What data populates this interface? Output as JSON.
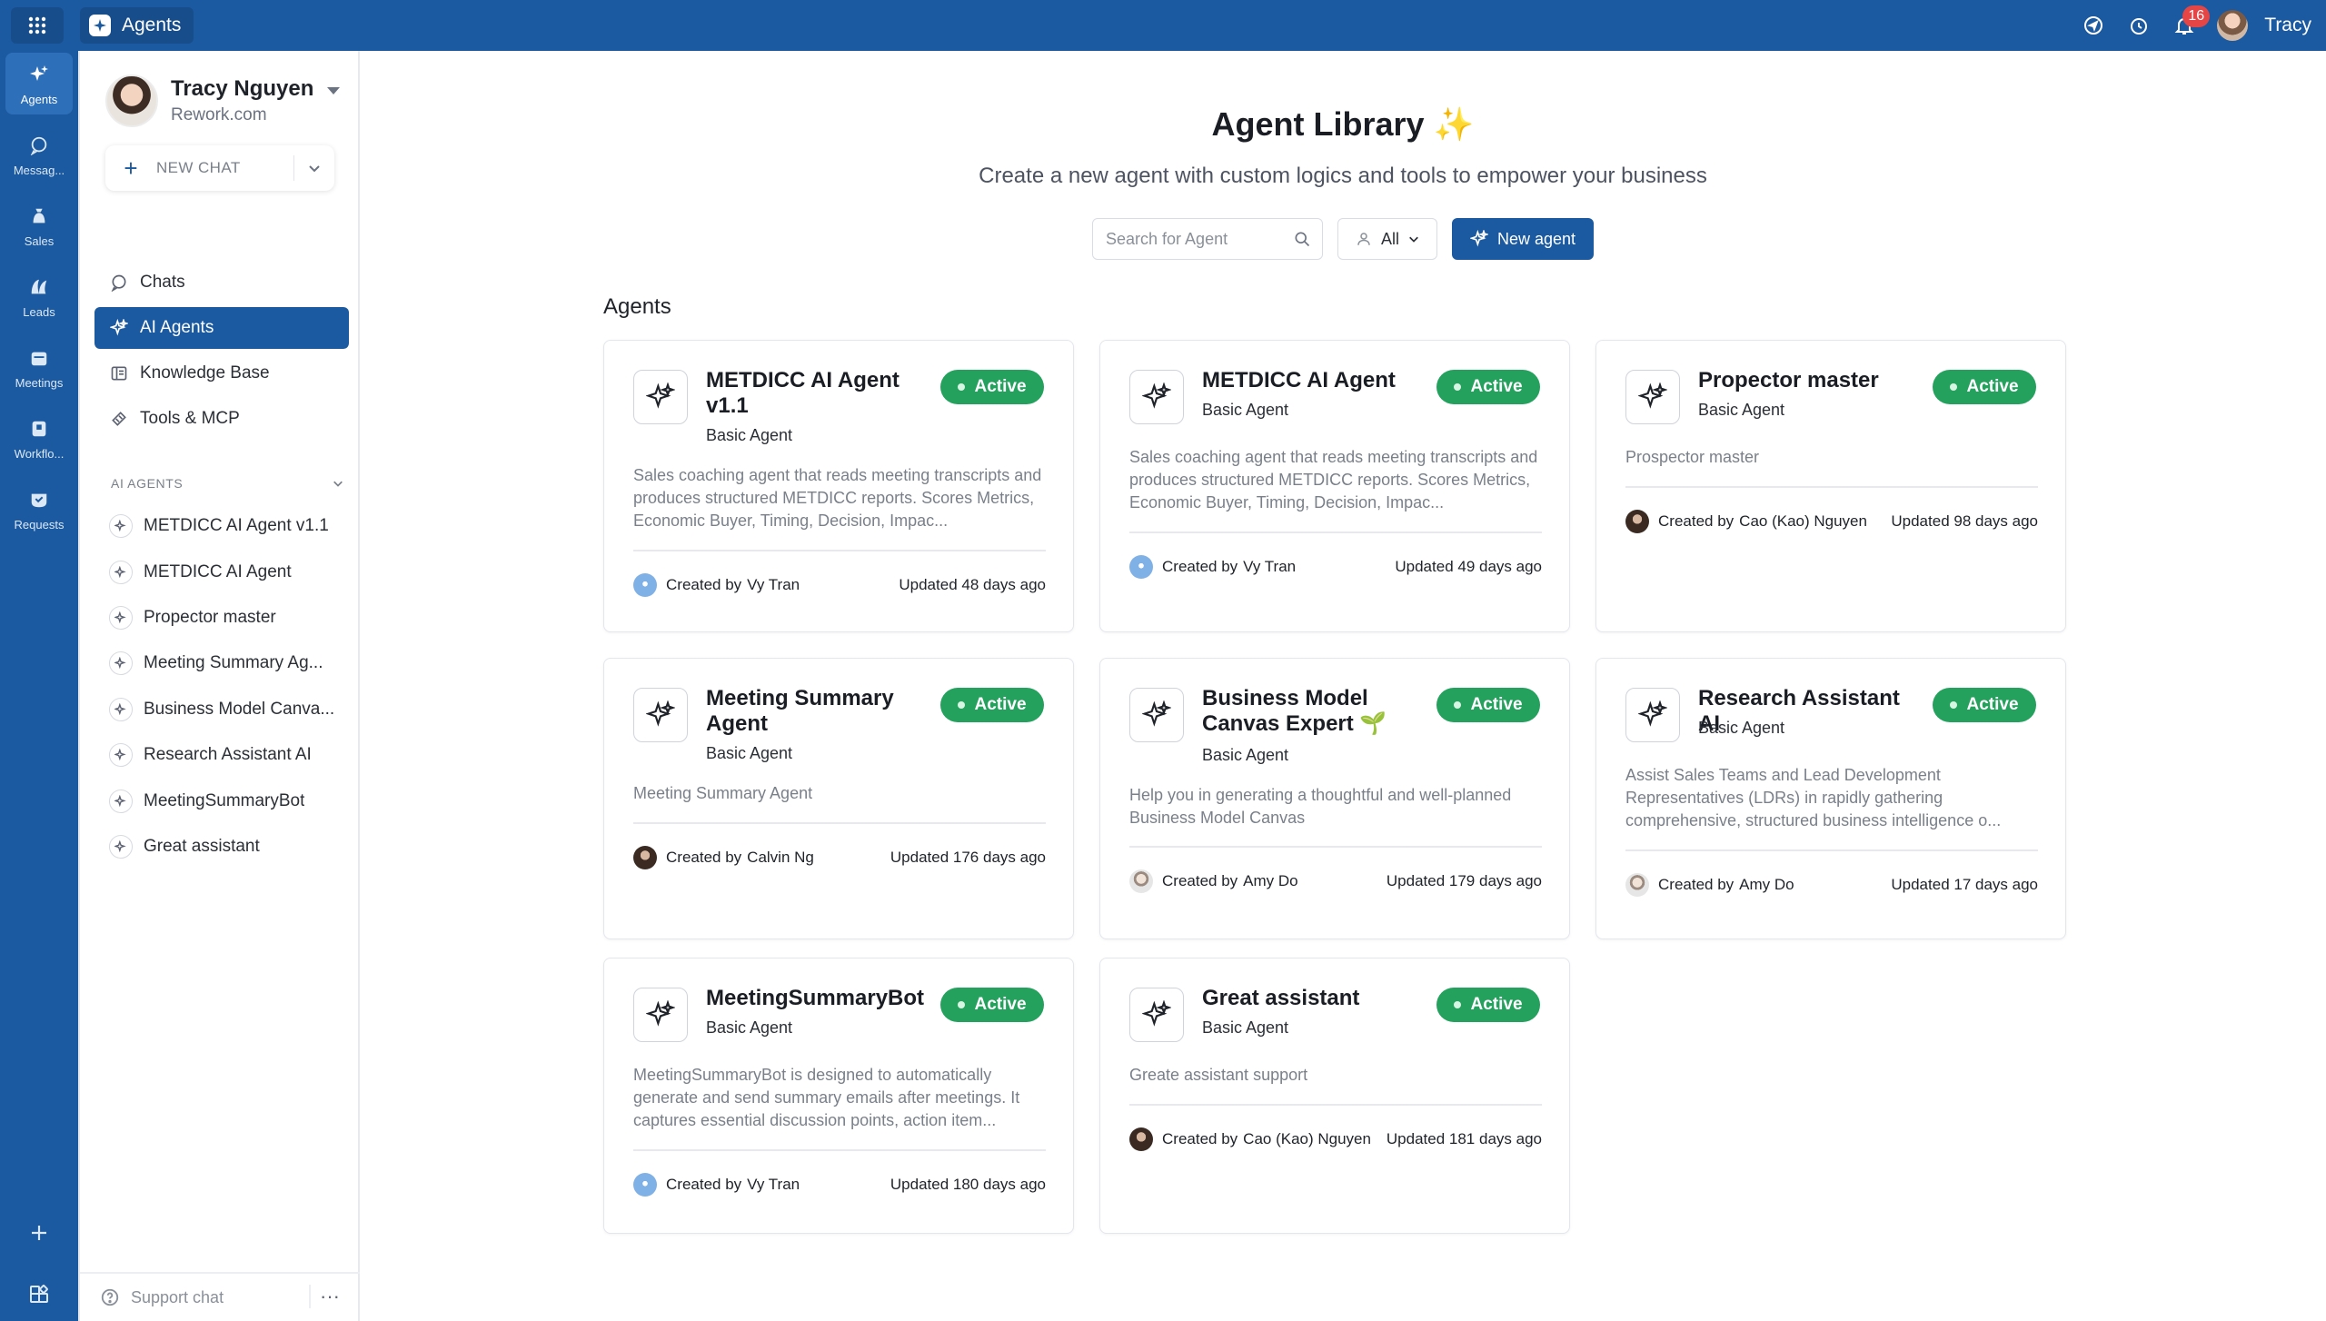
{
  "topbar": {
    "app_name": "Agents",
    "notif_count": "16",
    "user_name": "Tracy"
  },
  "rail": [
    {
      "label": "Agents",
      "icon": "sparkles-icon",
      "active": true
    },
    {
      "label": "Messag...",
      "icon": "message-icon"
    },
    {
      "label": "Sales",
      "icon": "money-bag-icon"
    },
    {
      "label": "Leads",
      "icon": "leads-icon"
    },
    {
      "label": "Meetings",
      "icon": "calendar-icon"
    },
    {
      "label": "Workflo...",
      "icon": "workflow-icon"
    },
    {
      "label": "Requests",
      "icon": "inbox-check-icon"
    }
  ],
  "sidebar": {
    "profile_name": "Tracy Nguyen",
    "profile_company": "Rework.com",
    "new_chat_label": "NEW CHAT",
    "nav": [
      {
        "label": "Chats",
        "icon": "chat-icon"
      },
      {
        "label": "AI Agents",
        "icon": "ai-agents-icon",
        "active": true
      },
      {
        "label": "Knowledge Base",
        "icon": "book-icon"
      },
      {
        "label": "Tools & MCP",
        "icon": "tools-icon"
      }
    ],
    "section_label": "AI AGENTS",
    "agents": [
      "METDICC AI Agent v1.1",
      "METDICC AI Agent",
      "Propector master",
      "Meeting Summary Ag...",
      "Business Model Canva...",
      "Research Assistant AI",
      "MeetingSummaryBot",
      "Great assistant"
    ],
    "support_label": "Support chat"
  },
  "main": {
    "title": "Agent Library",
    "title_emoji": "✨",
    "subtitle": "Create a new agent with custom logics and tools to empower your business",
    "search_placeholder": "Search for Agent",
    "filter_label": "All",
    "new_agent_label": "New agent",
    "section_title": "Agents"
  },
  "cards": [
    {
      "name": "METDICC AI Agent v1.1",
      "type": "Basic Agent",
      "status": "Active",
      "desc": "Sales coaching agent that reads meeting transcripts and produces structured METDICC reports. Scores Metrics, Economic Buyer, Timing, Decision, Impac...",
      "created_prefix": "Created by",
      "creator": "Vy Tran",
      "updated": "Updated 48 days ago"
    },
    {
      "name": "METDICC AI Agent",
      "type": "Basic Agent",
      "status": "Active",
      "desc": "Sales coaching agent that reads meeting transcripts and produces structured METDICC reports. Scores Metrics, Economic Buyer, Timing, Decision, Impac...",
      "created_prefix": "Created by",
      "creator": "Vy Tran",
      "updated": "Updated 49 days ago"
    },
    {
      "name": "Propector master",
      "type": "Basic Agent",
      "status": "Active",
      "desc": "Prospector master",
      "created_prefix": "Created by",
      "creator": "Cao (Kao) Nguyen",
      "updated": "Updated 98 days ago"
    },
    {
      "name": "Meeting Summary Agent",
      "type": "Basic Agent",
      "status": "Active",
      "desc": "Meeting Summary Agent",
      "created_prefix": "Created by",
      "creator": "Calvin Ng",
      "updated": "Updated 176 days ago"
    },
    {
      "name": "Business Model Canvas Expert 🌱",
      "type": "Basic Agent",
      "status": "Active",
      "desc": "Help you in generating a thoughtful and well-planned Business Model Canvas",
      "created_prefix": "Created by",
      "creator": "Amy Do",
      "updated": "Updated 179 days ago"
    },
    {
      "name": "Research Assistant AI",
      "type": "Basic Agent",
      "status": "Active",
      "desc": "Assist Sales Teams and Lead Development Representatives (LDRs) in rapidly gathering comprehensive, structured business intelligence o...",
      "created_prefix": "Created by",
      "creator": "Amy Do",
      "updated": "Updated 17 days ago"
    },
    {
      "name": "MeetingSummaryBot",
      "type": "Basic Agent",
      "status": "Active",
      "desc": "MeetingSummaryBot is designed to automatically generate and send summary emails after meetings. It captures essential discussion points, action item...",
      "created_prefix": "Created by",
      "creator": "Vy Tran",
      "updated": "Updated 180 days ago"
    },
    {
      "name": "Great assistant",
      "type": "Basic Agent",
      "status": "Active",
      "desc": "Greate assistant support",
      "created_prefix": "Created by",
      "creator": "Cao (Kao) Nguyen",
      "updated": "Updated 181 days ago"
    }
  ],
  "colors": {
    "brand": "#1b5aa0",
    "active_badge": "#23a15d",
    "notif_badge": "#e54545"
  }
}
